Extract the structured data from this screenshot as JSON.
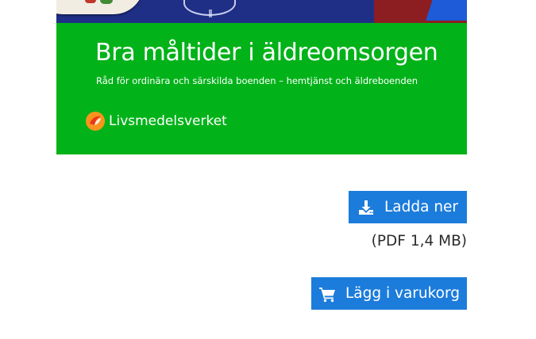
{
  "cover": {
    "title": "Bra måltider i äldreomsorgen",
    "subtitle": "Råd för ordinära och särskilda boenden – hemtjänst och äldreboenden",
    "publisher": "Livsmedelsverket",
    "band_color": "#02b219",
    "logo_icon": "livsmedelsverket-logo-icon"
  },
  "download": {
    "label": "Ladda ner",
    "icon": "download-icon",
    "file_info": "(PDF 1,4 MB)"
  },
  "cart": {
    "label": "Lägg i varukorg",
    "icon": "shopping-cart-icon"
  },
  "colors": {
    "button": "#1c7cdb",
    "accent_green": "#02b219",
    "logo_orange": "#f7941d"
  }
}
